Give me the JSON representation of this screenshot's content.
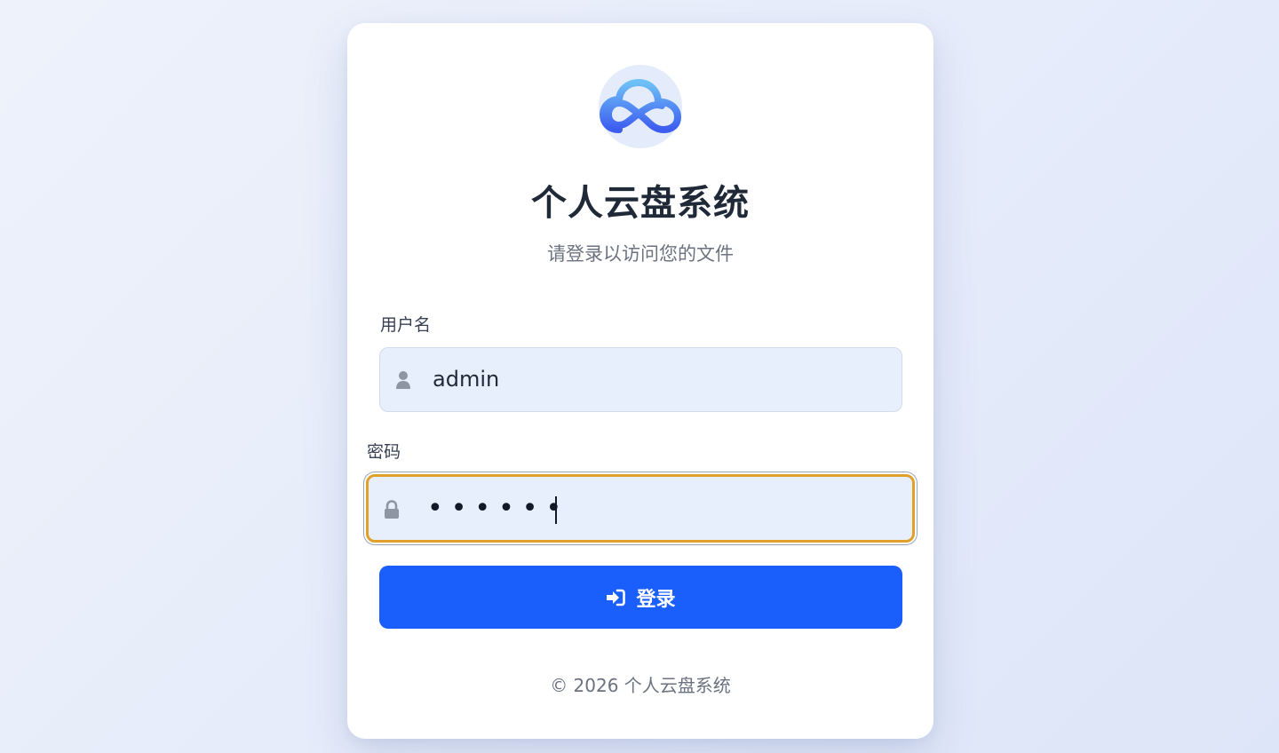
{
  "app": {
    "title": "个人云盘系统",
    "subtitle": "请登录以访问您的文件",
    "logo_icon": "cloud-icon"
  },
  "form": {
    "username": {
      "label": "用户名",
      "value": "admin",
      "icon": "user-icon"
    },
    "password": {
      "label": "密码",
      "masked_value": "••••••",
      "icon": "lock-icon",
      "focused": true
    },
    "submit": {
      "label": "登录",
      "icon": "sign-in-icon"
    }
  },
  "footer": {
    "text": "© 2026 个人云盘系统"
  },
  "colors": {
    "primary": "#1a5ffc",
    "focus_ring": "#e0a12a",
    "field_bg": "#e8effc",
    "page_bg": "#e6ecfa"
  }
}
